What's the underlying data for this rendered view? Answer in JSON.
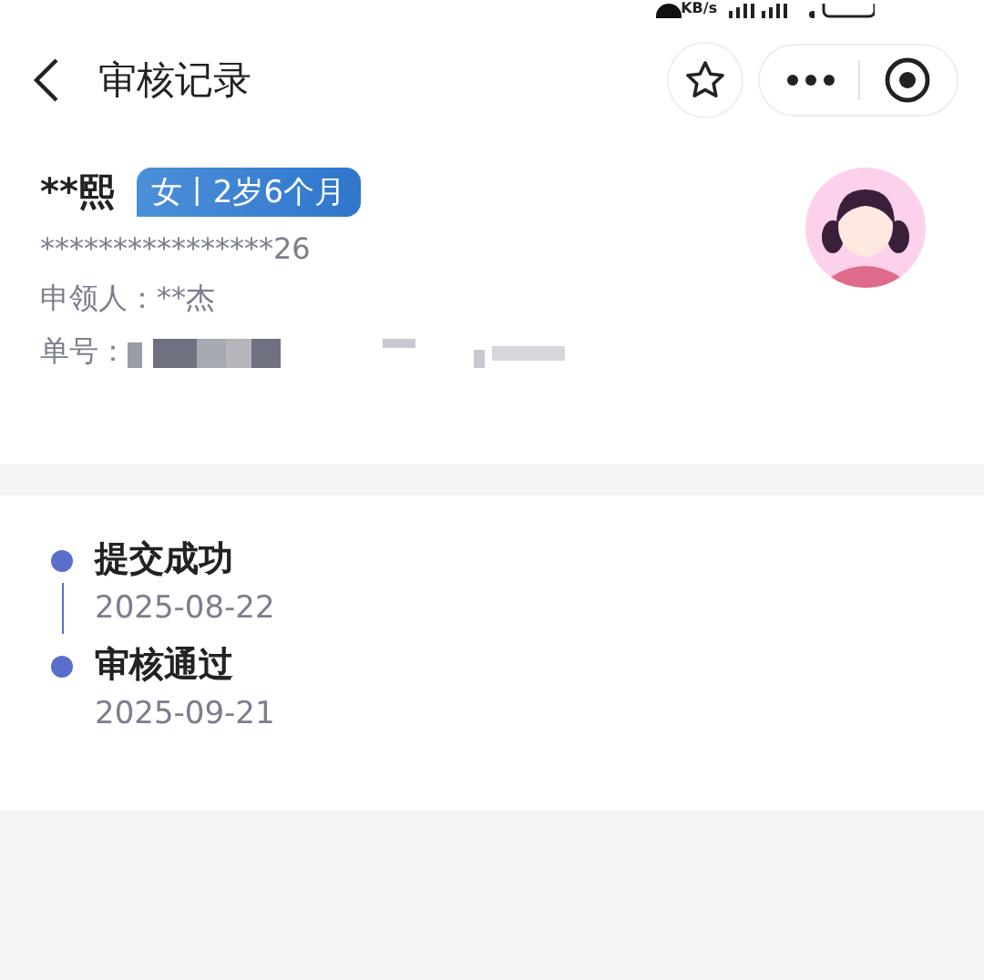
{
  "status_bar": {
    "speed": "KB/s"
  },
  "nav": {
    "title": "审核记录"
  },
  "profile": {
    "name": "**熙",
    "tag": "女丨2岁6个月",
    "id_number": "****************26",
    "applicant_label": "申领人：",
    "applicant": "**杰",
    "order_label": "单号："
  },
  "timeline": [
    {
      "title": "提交成功",
      "date": "2025-08-22"
    },
    {
      "title": "审核通过",
      "date": "2025-09-21"
    }
  ]
}
